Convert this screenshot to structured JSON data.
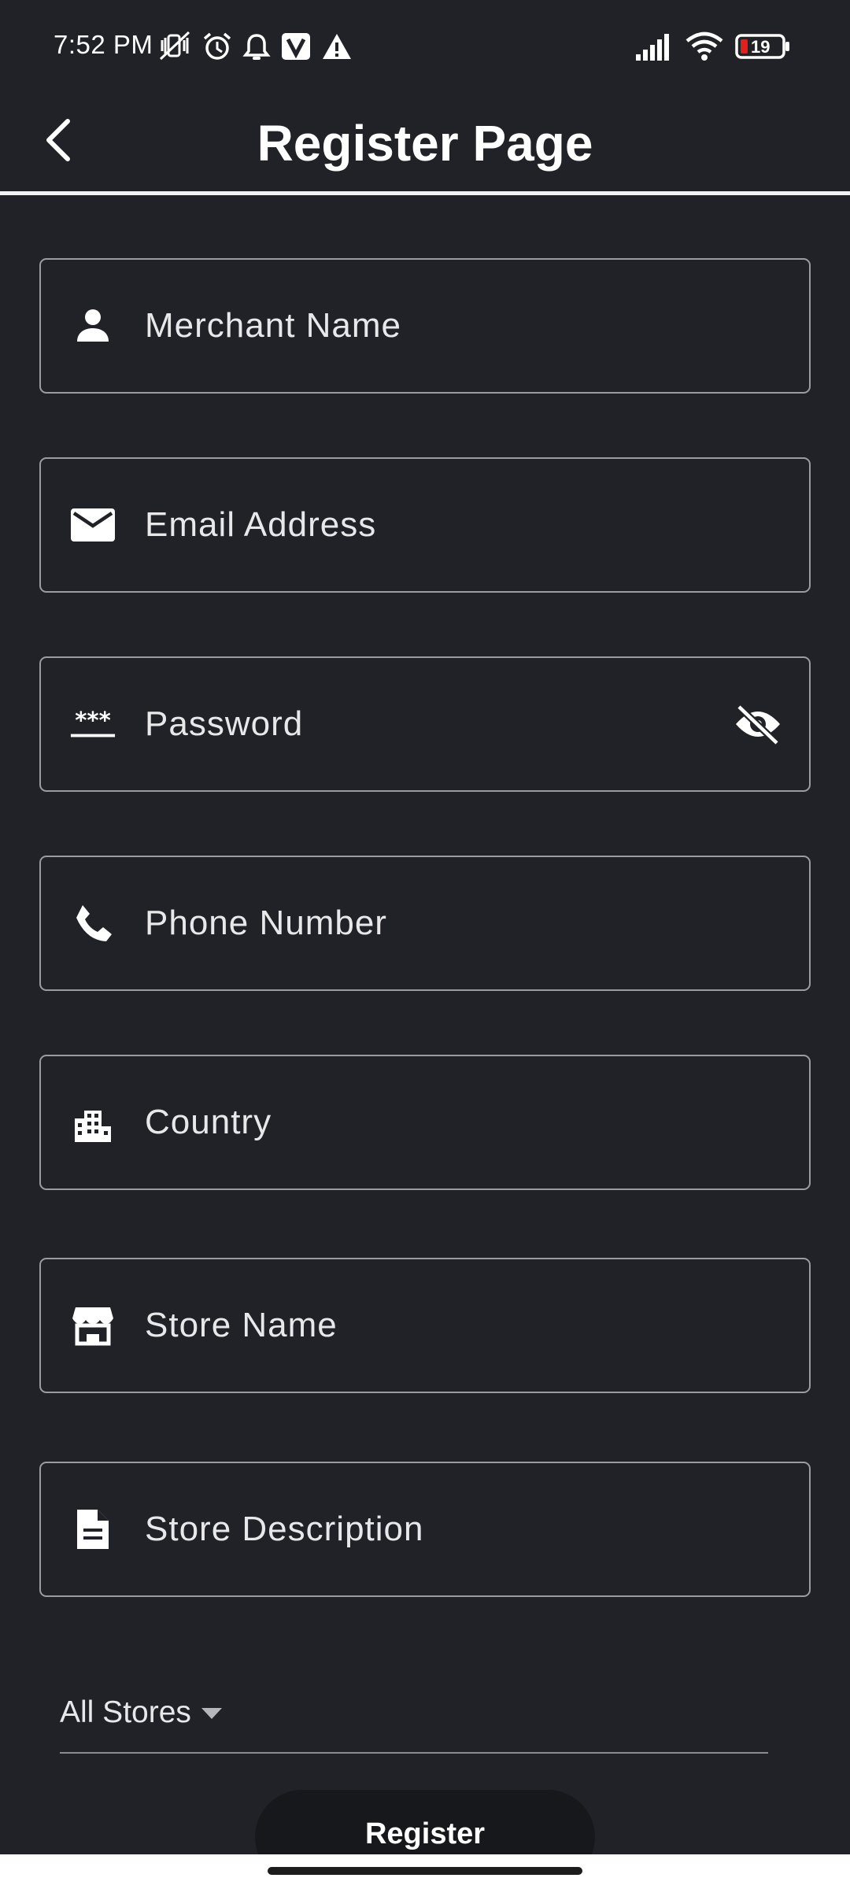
{
  "status_bar": {
    "time": "7:52 PM",
    "battery_level": "19",
    "left_icons": [
      "vibrate-off-icon",
      "alarm-icon",
      "notification-bell-icon",
      "v-app-icon",
      "warning-icon"
    ],
    "right_icons": [
      "cellular-signal-icon",
      "wifi-icon",
      "battery-low-icon"
    ]
  },
  "app_bar": {
    "title": "Register Page",
    "back_icon": "chevron-left-icon"
  },
  "form": {
    "fields": [
      {
        "placeholder": "Merchant Name",
        "icon": "person-icon"
      },
      {
        "placeholder": "Email Address",
        "icon": "email-icon"
      },
      {
        "placeholder": "Password",
        "icon": "password-icon",
        "trailing_icon": "visibility-off-icon"
      },
      {
        "placeholder": "Phone Number",
        "icon": "phone-icon"
      },
      {
        "placeholder": "Country",
        "icon": "city-icon"
      },
      {
        "placeholder": "Store Name",
        "icon": "store-icon"
      },
      {
        "placeholder": "Store Description",
        "icon": "document-icon"
      }
    ],
    "store_dropdown": {
      "selected": "All Stores"
    },
    "register_label": "Register"
  },
  "colors": {
    "background": "#212228",
    "field_border": "#9b9ca2",
    "text": "#e8e8ea",
    "battery_low": "#e0201c",
    "button_bg": "#17181c"
  }
}
